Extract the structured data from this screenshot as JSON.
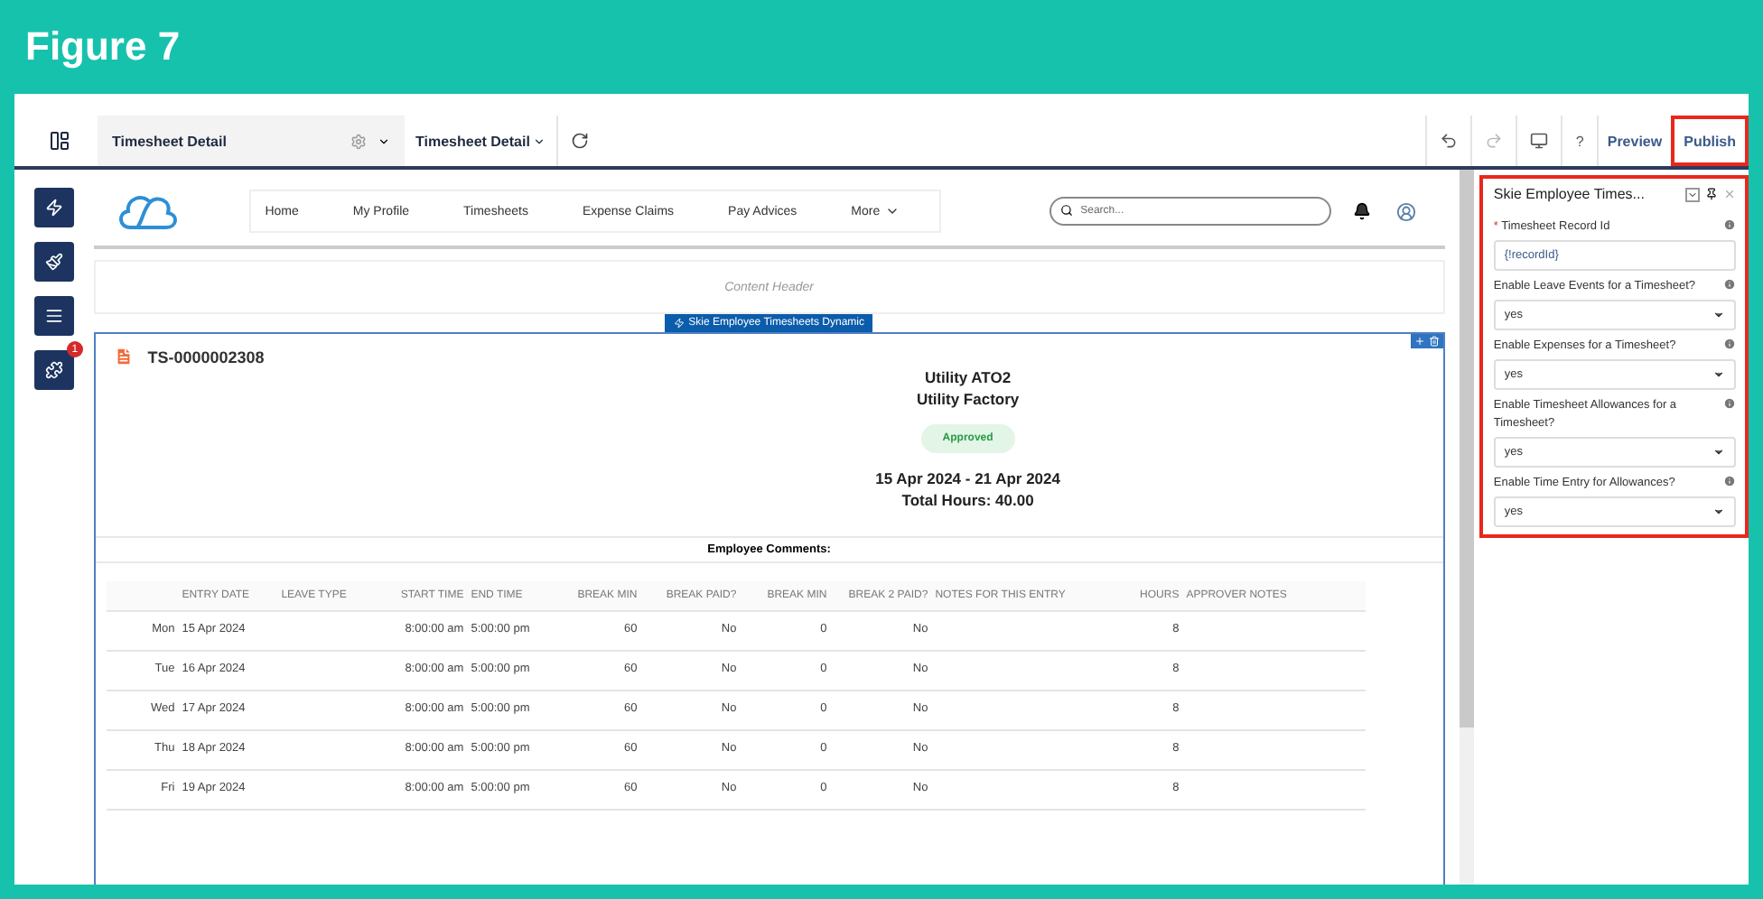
{
  "figure_title": "Figure 7",
  "toolbar": {
    "page_name": "Timesheet Detail",
    "view_menu": "Timesheet Detail",
    "help": "?",
    "preview": "Preview",
    "publish": "Publish",
    "publish_highlighted": true
  },
  "side_tools": [
    {
      "kind": "bolt"
    },
    {
      "kind": "brush"
    },
    {
      "kind": "list"
    },
    {
      "kind": "puzzle",
      "badge": "1"
    }
  ],
  "site_nav": {
    "items": [
      "Home",
      "My Profile",
      "Timesheets",
      "Expense Claims",
      "Pay Advices"
    ],
    "more": "More",
    "search": {
      "placeholder": "Search..."
    }
  },
  "content_header": "Content Header",
  "component_label": "Skie Employee Timesheets Dynamic",
  "record": {
    "id": "TS-0000002308",
    "lines": [
      "Utility ATO2",
      "Utility Factory"
    ],
    "status": "Approved",
    "date_range": "15 Apr 2024 - 21 Apr 2024",
    "total_hours": "Total Hours: 40.00",
    "comments_label": "Employee Comments:",
    "columns": [
      "",
      "ENTRY DATE",
      "LEAVE TYPE",
      "START TIME",
      "END TIME",
      "BREAK MIN",
      "BREAK PAID?",
      "BREAK MIN",
      "BREAK 2 PAID?",
      "NOTES FOR THIS ENTRY",
      "HOURS",
      "APPROVER NOTES"
    ],
    "rows": [
      [
        "Mon",
        "15 Apr 2024",
        "",
        "8:00:00 am",
        "5:00:00 pm",
        "60",
        "No",
        "0",
        "No",
        "",
        "8",
        ""
      ],
      [
        "Tue",
        "16 Apr 2024",
        "",
        "8:00:00 am",
        "5:00:00 pm",
        "60",
        "No",
        "0",
        "No",
        "",
        "8",
        ""
      ],
      [
        "Wed",
        "17 Apr 2024",
        "",
        "8:00:00 am",
        "5:00:00 pm",
        "60",
        "No",
        "0",
        "No",
        "",
        "8",
        ""
      ],
      [
        "Thu",
        "18 Apr 2024",
        "",
        "8:00:00 am",
        "5:00:00 pm",
        "60",
        "No",
        "0",
        "No",
        "",
        "8",
        ""
      ],
      [
        "Fri",
        "19 Apr 2024",
        "",
        "8:00:00 am",
        "5:00:00 pm",
        "60",
        "No",
        "0",
        "No",
        "",
        "8",
        ""
      ]
    ]
  },
  "properties_panel": {
    "title": "Skie Employee Times...",
    "highlighted": true,
    "fields": [
      {
        "kind": "text",
        "required_mark": "*",
        "label": "Timesheet Record Id",
        "value": "{!recordId}"
      },
      {
        "kind": "select",
        "label": "Enable Leave Events for a Timesheet?",
        "value": "yes"
      },
      {
        "kind": "select",
        "label": "Enable Expenses for a Timesheet?",
        "value": "yes"
      },
      {
        "kind": "select",
        "label": "Enable Timesheet Allowances for a Timesheet?",
        "value": "yes"
      },
      {
        "kind": "select",
        "label": "Enable Time Entry for Allowances?",
        "value": "yes"
      }
    ]
  }
}
